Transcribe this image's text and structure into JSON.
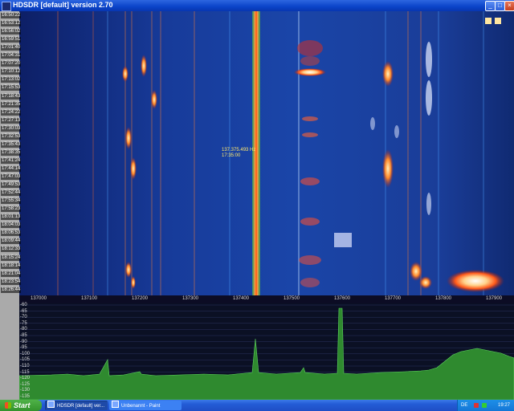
{
  "window": {
    "title": "HDSDR [default]  version 2.70",
    "min": "_",
    "max": "□",
    "close": "×"
  },
  "timestamps": [
    "16:50:22",
    "16:53:12",
    "16:56:02",
    "16:59:51",
    "17:01:40",
    "17:04:31",
    "17:07:20",
    "17:10:12",
    "17:13:02",
    "17:15:53",
    "17:18:43",
    "17:21:35",
    "17:24:22",
    "17:27:13",
    "17:30:03",
    "17:32:53",
    "17:35:43",
    "17:38:35",
    "17:41:24",
    "17:44:14",
    "17:47:03",
    "17:49:53",
    "17:52:44",
    "17:55:34",
    "17:58:23",
    "18:01:13",
    "18:04:03",
    "18:06:53",
    "18:09:44",
    "18:12:33",
    "18:15:24",
    "18:18:14",
    "18:21:04",
    "18:23:54",
    "18:26:44"
  ],
  "tooltip": {
    "freq": "137.375.493 Hz",
    "time": "17:35:00"
  },
  "freq_axis": [
    "137000",
    "137100",
    "137200",
    "137300",
    "137400",
    "137500",
    "137600",
    "137700",
    "137800",
    "137900"
  ],
  "db_axis": [
    "-60",
    "-65",
    "-70",
    "-75",
    "-80",
    "-85",
    "-90",
    "-95",
    "-100",
    "-105",
    "-110",
    "-115",
    "-120",
    "-125",
    "-130",
    "-135"
  ],
  "taskbar": {
    "start": "Start",
    "tasks": [
      {
        "label": "HDSDR [default]  ver..."
      },
      {
        "label": "Unbenannt - Paint"
      }
    ],
    "lang": "DE",
    "clock": "19:27"
  },
  "colors": {
    "waterfall_bg": "#10308a",
    "spectrum_fill": "#2f8a2f",
    "carrier": "#ff6a1a"
  }
}
